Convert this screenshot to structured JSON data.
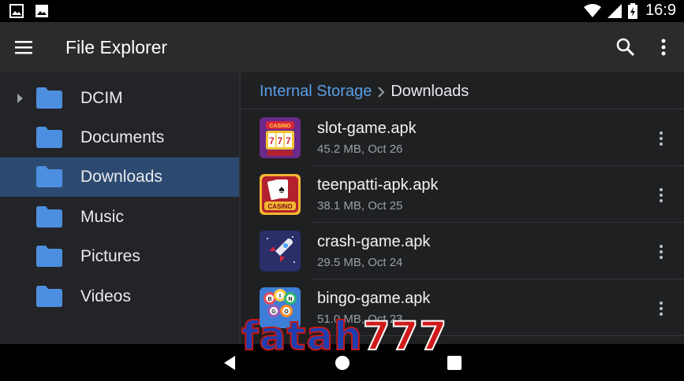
{
  "status_bar": {
    "time": "16:9"
  },
  "toolbar": {
    "title": "File Explorer",
    "menu_icon": "hamburger-menu-icon",
    "search_icon": "search-icon",
    "more_icon": "more-vert-icon"
  },
  "sidebar": {
    "items": [
      {
        "label": "DCIM",
        "expandable": true,
        "selected": false
      },
      {
        "label": "Documents",
        "expandable": false,
        "selected": false
      },
      {
        "label": "Downloads",
        "expandable": false,
        "selected": true
      },
      {
        "label": "Music",
        "expandable": false,
        "selected": false
      },
      {
        "label": "Pictures",
        "expandable": false,
        "selected": false
      },
      {
        "label": "Videos",
        "expandable": false,
        "selected": false
      }
    ]
  },
  "breadcrumb": {
    "root": "Internal Storage",
    "current": "Downloads"
  },
  "files": [
    {
      "name": "slot-game.apk",
      "meta": "45.2 MB, Oct 26",
      "icon": "slot-machine-casino-icon"
    },
    {
      "name": "teenpatti-apk.apk",
      "meta": "38.1 MB, Oct 25",
      "icon": "playing-cards-casino-icon"
    },
    {
      "name": "crash-game.apk",
      "meta": "29.5 MB, Oct 24",
      "icon": "rocket-icon"
    },
    {
      "name": "bingo-game.apk",
      "meta": "51.0 MB, Oct 23",
      "icon": "bingo-balls-icon"
    }
  ],
  "thumb_labels": {
    "casino1": "CASINO",
    "casino2": "CASINO",
    "b": "B",
    "i": "I",
    "n": "N",
    "g": "G",
    "o": "O"
  },
  "watermark": {
    "part1": "fatah",
    "part2": "777"
  },
  "colors": {
    "accent": "#5a9ee6",
    "selected_bg": "#2c4a70",
    "folder": "#4c8fe0"
  }
}
